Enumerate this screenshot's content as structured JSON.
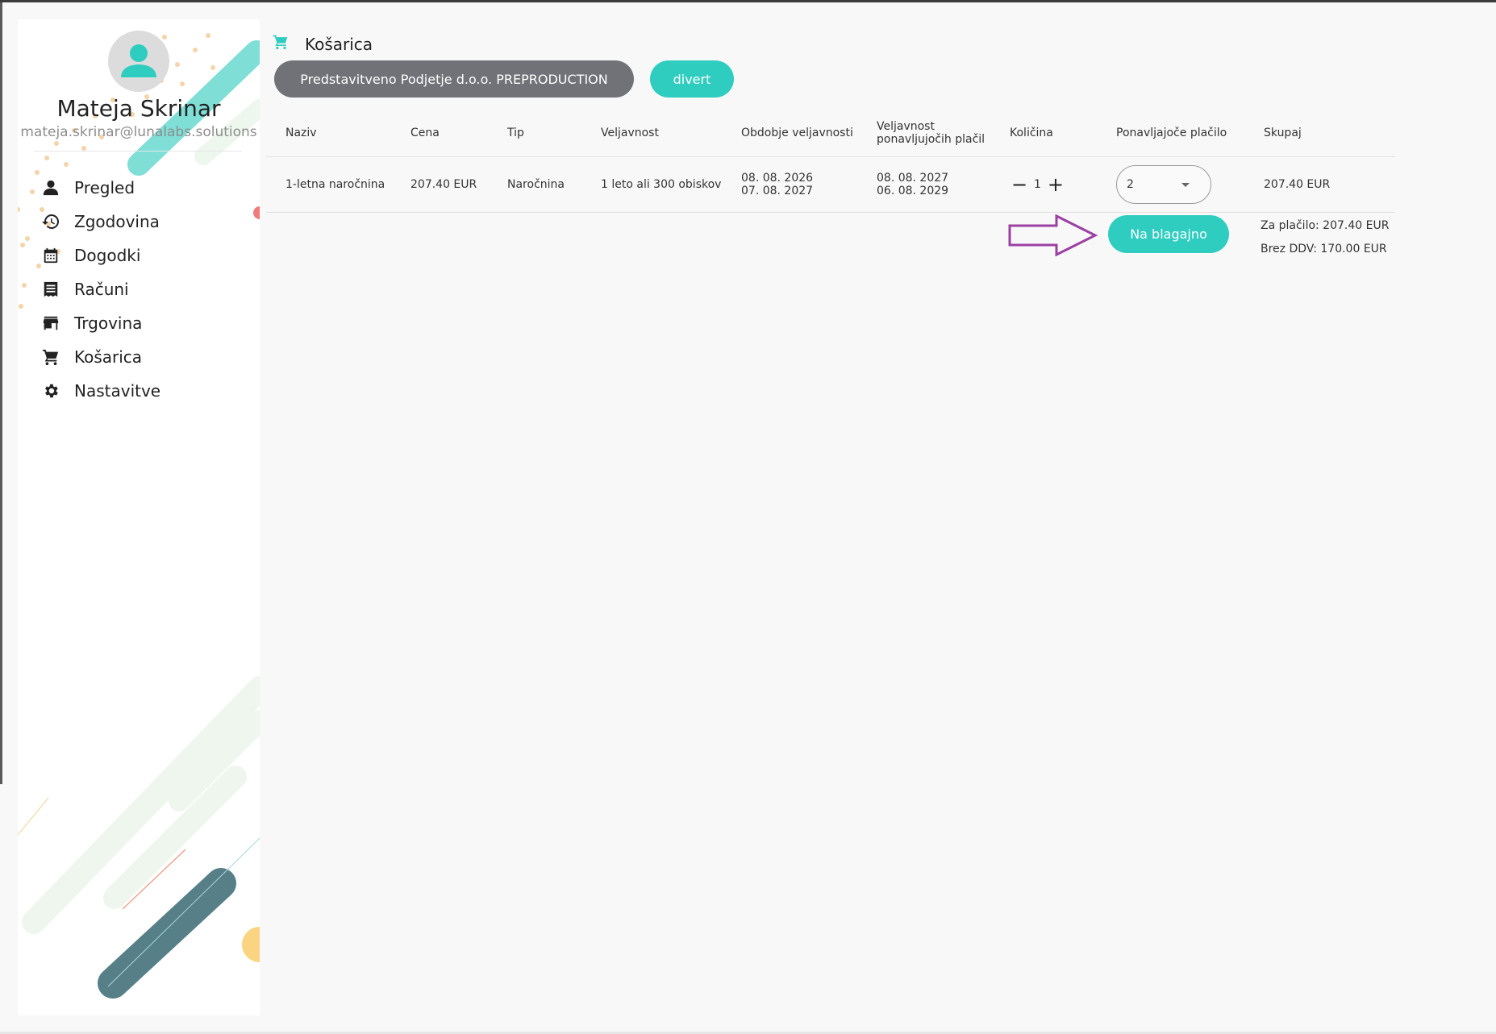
{
  "user": {
    "name": "Mateja Skrinar",
    "email": "mateja.skrinar@lunalabs.solutions",
    "avatar_icon": "person-icon"
  },
  "sidebar": {
    "items": [
      {
        "label": "Pregled",
        "icon": "person-icon"
      },
      {
        "label": "Zgodovina",
        "icon": "history-icon"
      },
      {
        "label": "Dogodki",
        "icon": "calendar-icon"
      },
      {
        "label": "Računi",
        "icon": "receipt-icon"
      },
      {
        "label": "Trgovina",
        "icon": "store-icon"
      },
      {
        "label": "Košarica",
        "icon": "cart-icon"
      },
      {
        "label": "Nastavitve",
        "icon": "gear-icon"
      }
    ]
  },
  "page": {
    "title": "Košarica",
    "title_icon": "cart-icon",
    "company_button": "Predstavitveno Podjetje d.o.o. PREPRODUCTION",
    "divert_button": "divert"
  },
  "table": {
    "headers": {
      "naziv": "Naziv",
      "cena": "Cena",
      "tip": "Tip",
      "veljavnost": "Veljavnost",
      "obdobje": "Obdobje veljavnosti",
      "veljavnost_placil_1": "Veljavnost",
      "veljavnost_placil_2": "ponavljujočih plačil",
      "kolicina": "Količina",
      "ponavljajoce": "Ponavljajoče plačilo",
      "skupaj": "Skupaj"
    },
    "rows": [
      {
        "naziv": "1-letna naročnina",
        "cena": "207.40 EUR",
        "tip": "Naročnina",
        "veljavnost": "1 leto ali 300 obiskov",
        "obdobje_od": "08. 08. 2026",
        "obdobje_do": "07. 08. 2027",
        "placila_od": "08. 08. 2027",
        "placila_do": "06. 08. 2029",
        "minus": "−",
        "kolicina": "1",
        "plus": "+",
        "ponavljajoce": "2",
        "skupaj": "207.40 EUR"
      }
    ]
  },
  "checkout": {
    "button": "Na blagajno",
    "za_placilo": "Za plačilo: 207.40 EUR",
    "brez_ddv": "Brez DDV: 170.00 EUR",
    "annotation_color": "#9b3fa3"
  },
  "colors": {
    "accent": "#2fcdc0",
    "company_button": "#707277"
  }
}
